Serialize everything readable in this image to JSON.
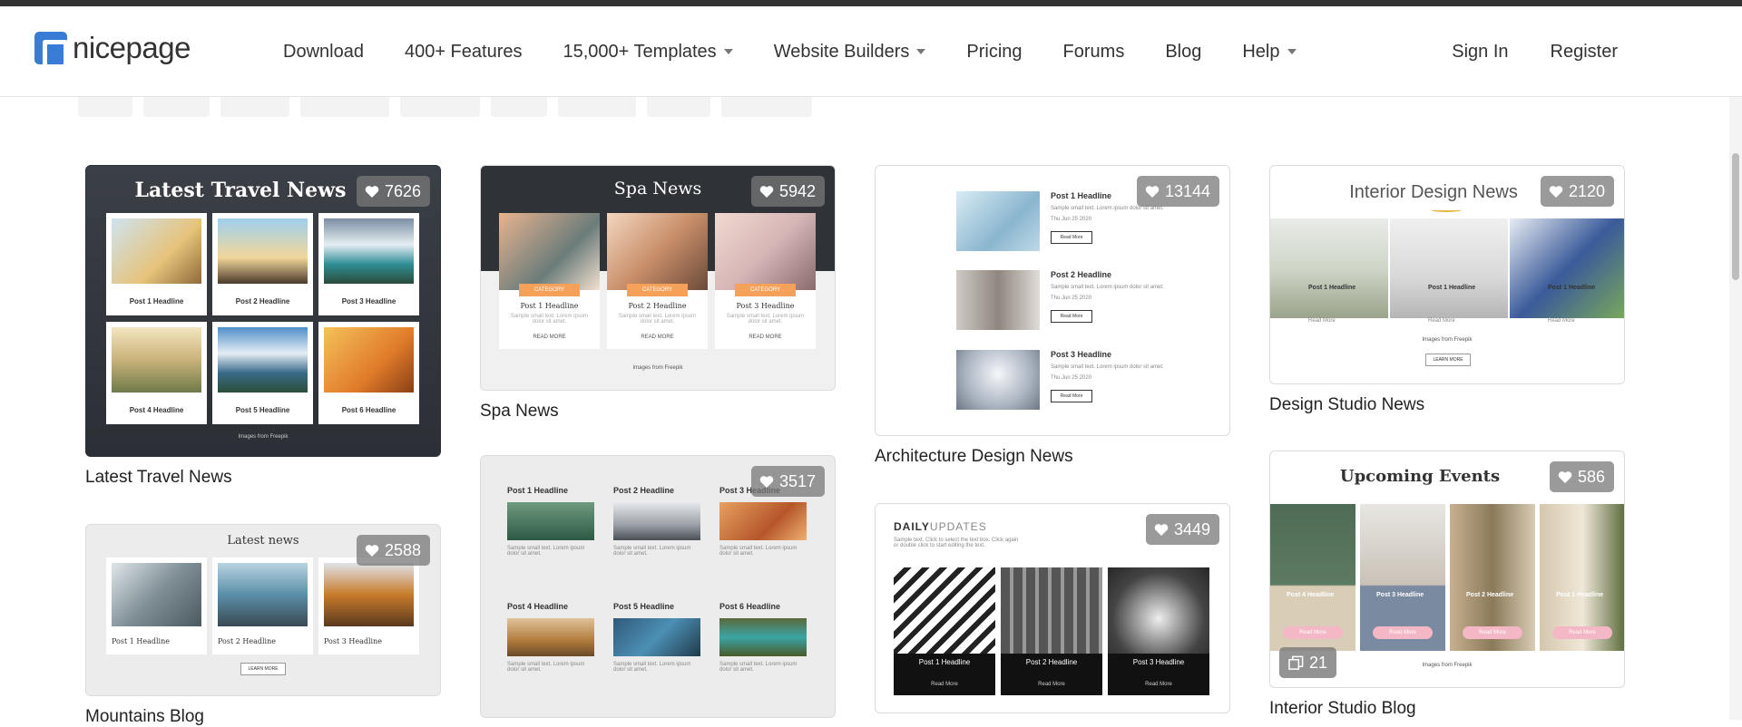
{
  "brand": {
    "name": "nicepage"
  },
  "nav": {
    "download": "Download",
    "features": "400+ Features",
    "templates": "15,000+ Templates",
    "builders": "Website Builders",
    "pricing": "Pricing",
    "forums": "Forums",
    "blog": "Blog",
    "help": "Help"
  },
  "auth": {
    "signin": "Sign In",
    "register": "Register"
  },
  "colors": {
    "accent": "#3a7bd5",
    "like_badge": "#7a7a7a"
  },
  "cards": {
    "travel": {
      "title": "Latest Travel News",
      "likes": "7626",
      "inner_title": "Latest Travel News",
      "posts": [
        "Post 1 Headline",
        "Post 2 Headline",
        "Post 3 Headline",
        "Post 4 Headline",
        "Post 5 Headline",
        "Post 6 Headline"
      ],
      "footer": "Images from Freepik"
    },
    "spa": {
      "title": "Spa News",
      "likes": "5942",
      "inner_title": "Spa News",
      "category": "CATEGORY",
      "posts": [
        "Post 1 Headline",
        "Post 2 Headline",
        "Post 3 Headline"
      ],
      "read_more": "READ MORE",
      "footer": "Images from Freepik",
      "sample": "Sample small text. Lorem ipsum dolor sit amet."
    },
    "architecture": {
      "title": "Architecture Design News",
      "likes": "13144",
      "posts": [
        "Post 1 Headline",
        "Post 2 Headline",
        "Post 3 Headline"
      ],
      "date": "Thu Jun 25 2020",
      "read_more": "Read More",
      "sample": "Sample small text. Lorem ipsum dolor sit amet."
    },
    "design_studio": {
      "title": "Design Studio News",
      "likes": "2120",
      "inner_title": "Interior Design News",
      "posts": [
        "Post 1 Headline",
        "Post 1 Headline",
        "Post 1 Headline"
      ],
      "read_more": "Read More",
      "footer": "Images from Freepik",
      "learn_more": "LEARN MORE"
    },
    "mountains": {
      "title": "Mountains Blog",
      "likes": "2588",
      "inner_title": "Latest news",
      "posts": [
        "Post 1 Headline",
        "Post 2 Headline",
        "Post 3 Headline"
      ],
      "learn_more": "LEARN MORE"
    },
    "six_posts": {
      "likes": "3517",
      "posts": [
        "Post 1 Headline",
        "Post 2 Headline",
        "Post 3 Headline",
        "Post 4 Headline",
        "Post 5 Headline",
        "Post 6 Headline"
      ],
      "sample": "Sample small text. Lorem ipsum dolor sit amet."
    },
    "daily": {
      "likes": "3449",
      "inner_title_bold": "DAILY",
      "inner_title_light": "UPDATES",
      "sample": "Sample text. Click to select the text box. Click again or double click to start editing the text.",
      "posts": [
        "Post 1 Headline",
        "Post 2 Headline",
        "Post 3 Headline"
      ],
      "read_more": "Read More"
    },
    "interior_studio": {
      "title": "Interior Studio Blog",
      "likes": "586",
      "pages": "21",
      "inner_title": "Upcoming Events",
      "posts": [
        "Post 4 Headline",
        "Post 3 Headline",
        "Post 2 Headline",
        "Post 1 Headline"
      ],
      "read_more": "Read More",
      "footer": "Images from Freepik"
    }
  }
}
